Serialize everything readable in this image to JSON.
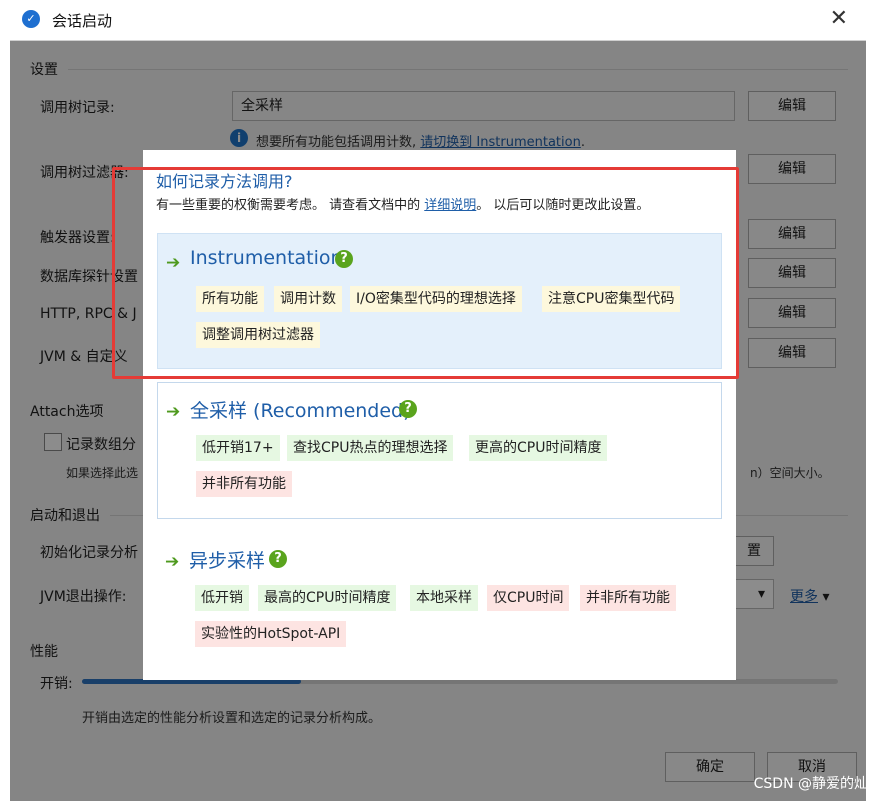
{
  "window": {
    "title": "会话启动",
    "close_symbol": "✕"
  },
  "settings": {
    "section_title": "设置",
    "call_tree_recording_label": "调用树记录:",
    "call_tree_recording_value": "全采样",
    "info_text": "想要所有功能包括调用计数,",
    "info_link": "请切换到 Instrumentation",
    "info_end": ".",
    "call_tree_filter_label": "调用树过滤器:",
    "trigger_label": "触发器设置:",
    "db_probe_label": "数据库探针设置",
    "http_label": "HTTP, RPC & J",
    "jvm_custom_label": "JVM & 自定义",
    "edit_label": "编辑"
  },
  "attach": {
    "section_title": "Attach选项",
    "record_array_label": "记录数组分",
    "note_start": "如果选择此选",
    "note_end": "n）空间大小。"
  },
  "startup": {
    "section_title": "启动和退出",
    "init_label": "初始化记录分析",
    "init_button_tail": "置",
    "jvm_exit_label": "JVM退出操作:",
    "more_link": "更多",
    "dropdown_arrow": "▾"
  },
  "performance": {
    "section_title": "性能",
    "overhead_label": "开销:",
    "overhead_fraction": 0.29,
    "description": "开销由选定的性能分析设置和选定的记录分析构成。"
  },
  "footer": {
    "ok_label": "确定",
    "cancel_label": "取消"
  },
  "popup": {
    "title": "如何记录方法调用?",
    "subtitle_before": "有一些重要的权衡需要考虑。 请查看文档中的 ",
    "subtitle_link": "详细说明",
    "subtitle_after": "。 以后可以随时更改此设置。",
    "arrow_symbol": "➔",
    "help_symbol": "?",
    "options": [
      {
        "title": "Instrumentation",
        "tags": [
          "所有功能",
          "调用计数",
          "I/O密集型代码的理想选择",
          "注意CPU密集型代码",
          "调整调用树过滤器"
        ]
      },
      {
        "title": "全采样 (Recommended)",
        "tags": [
          "低开销17+",
          "查找CPU热点的理想选择",
          "更高的CPU时间精度",
          "并非所有功能"
        ]
      },
      {
        "title": "异步采样",
        "tags": [
          "低开销",
          "最高的CPU时间精度",
          "本地采样",
          "仅CPU时间",
          "并非所有功能",
          "实验性的HotSpot-API"
        ]
      }
    ]
  },
  "watermark": "CSDN @静爱的灿",
  "colors": {
    "accent_blue": "#1f5ea8",
    "highlight_red": "#e53b36",
    "help_green": "#5aa41d",
    "info_blue": "#1e73c8"
  }
}
